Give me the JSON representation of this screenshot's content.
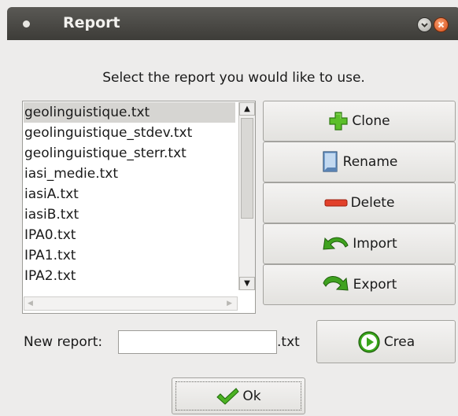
{
  "window": {
    "title": "Report"
  },
  "prompt": "Select the report you would like to use.",
  "report_list": {
    "items": [
      "geolinguistique.txt",
      "geolinguistique_stdev.txt",
      "geolinguistique_sterr.txt",
      "iasi_medie.txt",
      "iasiA.txt",
      "iasiB.txt",
      "IPA0.txt",
      "IPA1.txt",
      "IPA2.txt"
    ],
    "selected": "geolinguistique.txt"
  },
  "actions": {
    "clone_label": "Clone",
    "rename_label": "Rename",
    "delete_label": "Delete",
    "import_label": "Import",
    "export_label": "Export"
  },
  "new_report": {
    "label": "New report:",
    "value": "",
    "extension": ".txt",
    "create_label": "Crea"
  },
  "ok_label": "Ok",
  "icons": {
    "clone": "plus-icon",
    "rename": "document-icon",
    "delete": "minus-icon",
    "import": "import-arrow-icon",
    "export": "export-arrow-icon",
    "create": "play-icon",
    "ok": "checkmark-icon"
  },
  "colors": {
    "titlebar": "#4a4945",
    "close_button": "#e05a22",
    "selection": "#d6d5d2",
    "green_icon": "#3c9a1e",
    "red_icon": "#d8341c"
  }
}
